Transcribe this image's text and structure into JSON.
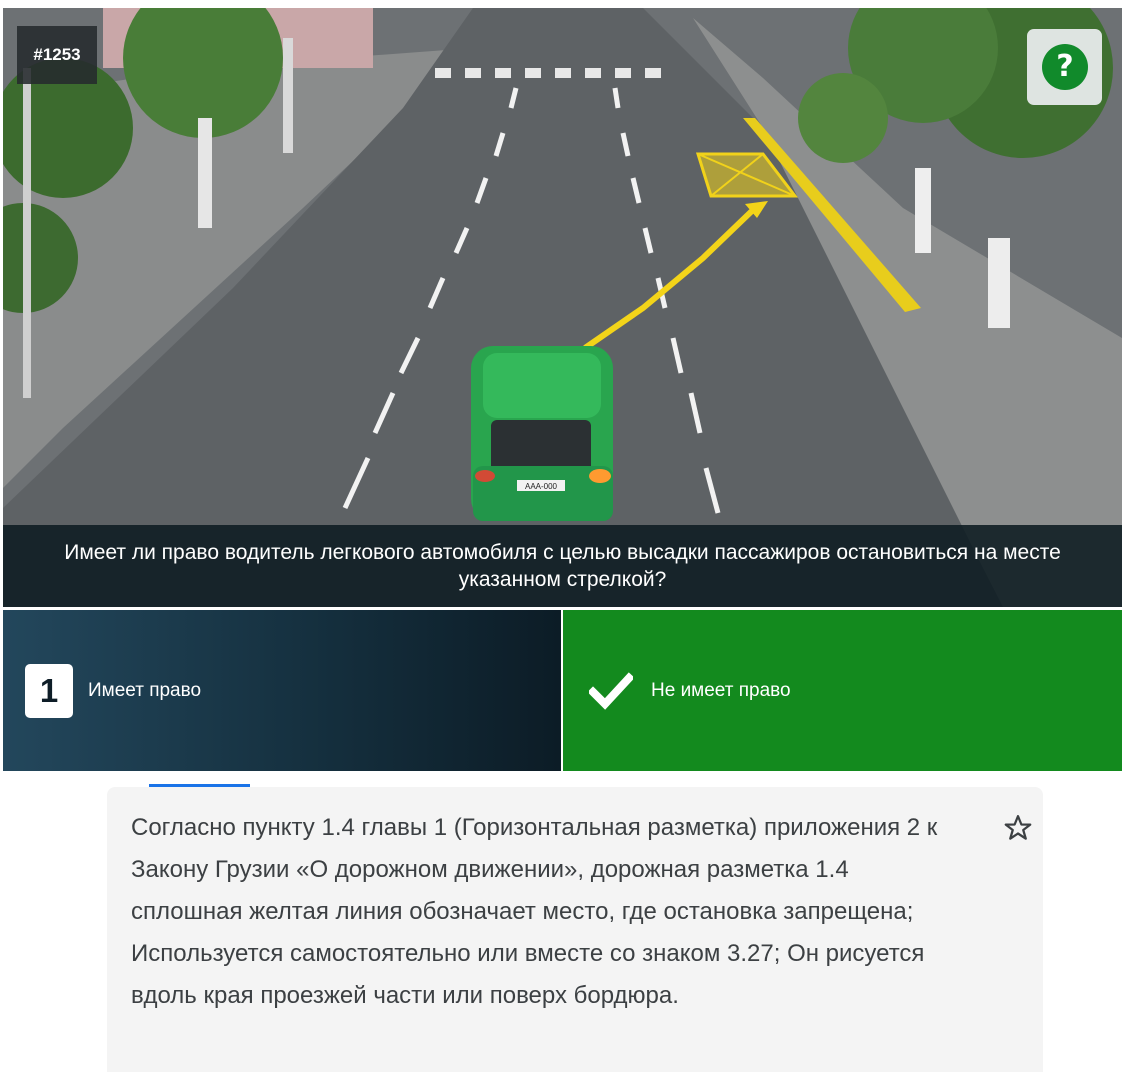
{
  "question": {
    "id_label": "#1253",
    "help_glyph": "?",
    "text": "Имеет ли право водитель легкового автомобиля с целью высадки пассажиров остановиться на месте указанном стрелкой?"
  },
  "scene": {
    "car_plate": "AAA-000",
    "description_icon": "road-scene-illustration"
  },
  "answers": [
    {
      "number": "1",
      "label": "Имеет право",
      "state": "default"
    },
    {
      "label": "Не имеет право",
      "state": "correct",
      "icon": "check-icon"
    }
  ],
  "explanation": {
    "text": "Согласно пункту 1.4 главы 1 (Горизонтальная разметка) приложения 2 к Закону Грузии «О дорожном движении», дорожная разметка 1.4 сплошная желтая линия обозначает место, где остановка запрещена; Используется самостоятельно или вместе со знаком 3.27; Он рисуется вдоль края проезжей части или поверх бордюра.",
    "bookmark_icon": "star-outline-icon"
  },
  "colors": {
    "correct": "#138a1e",
    "help": "#118a2b",
    "tab_accent": "#1a73e8",
    "yellow_marking": "#f1d21a"
  }
}
